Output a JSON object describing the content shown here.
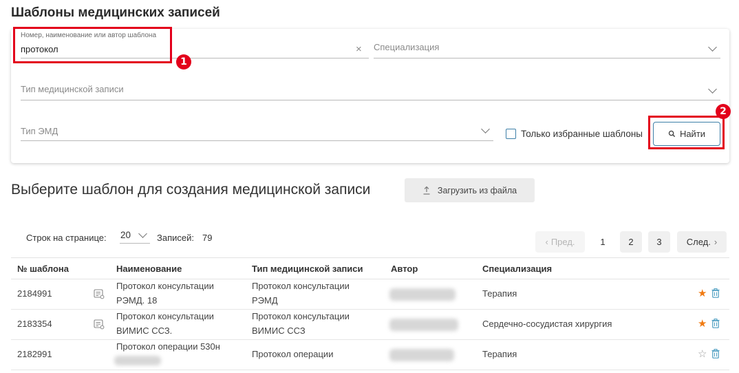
{
  "page_title": "Шаблоны медицинских записей",
  "filters": {
    "search_label": "Номер, наименование или автор шаблона",
    "search_value": "протокол",
    "specialization_placeholder": "Специализация",
    "record_type_placeholder": "Тип медицинской записи",
    "emd_type_placeholder": "Тип ЭМД",
    "favorites_only_label": "Только избранные шаблоны",
    "favorites_only_checked": false,
    "find_button": "Найти"
  },
  "annotations": [
    "1",
    "2"
  ],
  "section_title": "Выберите шаблон для создания медицинской записи",
  "upload_button": "Загрузить из файла",
  "pagination": {
    "rows_per_page_label": "Строк на странице:",
    "rows_per_page": "20",
    "records_label": "Записей:",
    "records_count": "79",
    "prev": "Пред.",
    "next": "След.",
    "pages": [
      "1",
      "2",
      "3"
    ],
    "current_page": "1"
  },
  "table": {
    "columns": [
      "№ шаблона",
      "Наименование",
      "Тип медицинской записи",
      "Автор",
      "Специализация"
    ],
    "rows": [
      {
        "number": "2184991",
        "name_lines": [
          "Протокол консультации",
          "РЭМД. 18"
        ],
        "record_type_lines": [
          "Протокол консультации",
          "РЭМД"
        ],
        "specialization": "Терапия",
        "favorite": true,
        "has_template_icon": true
      },
      {
        "number": "2183354",
        "name_lines": [
          "Протокол консультации",
          "ВИМИС ССЗ."
        ],
        "record_type_lines": [
          "Протокол консультации",
          "ВИМИС ССЗ"
        ],
        "specialization": "Сердечно-сосудистая хирургия",
        "favorite": true,
        "has_template_icon": true
      },
      {
        "number": "2182991",
        "name_lines": [
          "Протокол операции 530н"
        ],
        "record_type_lines": [
          "Протокол операции"
        ],
        "specialization": "Терапия",
        "favorite": false,
        "has_template_icon": false
      }
    ]
  },
  "colors": {
    "accent": "#3d7fa8",
    "highlight": "#e3001b",
    "favorite_star": "#f07a12",
    "trash": "#4a9cc0"
  }
}
